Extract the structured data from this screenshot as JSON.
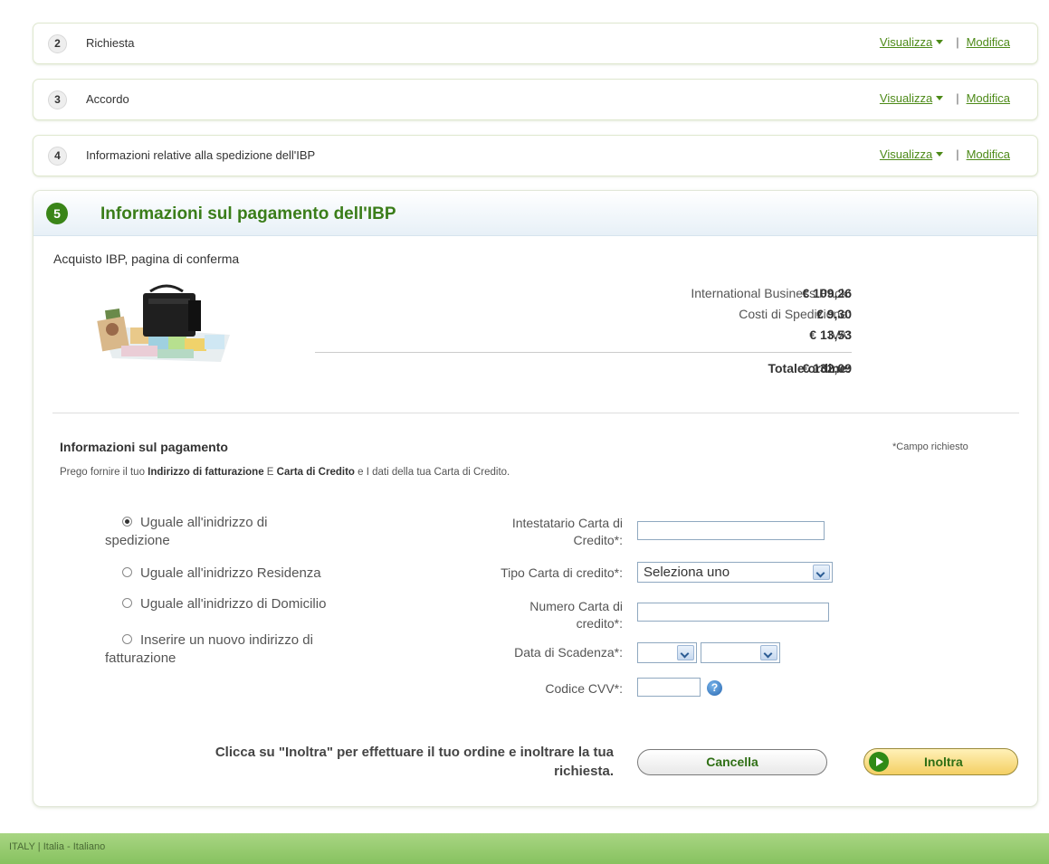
{
  "steps": [
    {
      "num": "2",
      "title": "Richiesta",
      "view_label": "Visualizza",
      "edit_label": "Modifica"
    },
    {
      "num": "3",
      "title": "Accordo",
      "view_label": "Visualizza",
      "edit_label": "Modifica"
    },
    {
      "num": "4",
      "title": "Informazioni relative alla spedizione dell'IBP",
      "view_label": "Visualizza",
      "edit_label": "Modifica"
    }
  ],
  "separator": "|",
  "panel": {
    "num": "5",
    "title": "Informazioni sul pagamento dell'IBP"
  },
  "confirmation": {
    "title": "Acquisto IBP, pagina di conferma",
    "summary": [
      {
        "label": "International Business Pack:",
        "value": "€ 109,26"
      },
      {
        "label": "Costi di Spedizione:",
        "value": "€ 9,30"
      },
      {
        "label": "IVA:",
        "value": "€ 13,53"
      }
    ],
    "total_label": "Totale ordine:",
    "total_value": "€ 132,09"
  },
  "payment": {
    "title": "Informazioni sul pagamento",
    "required_note": "*Campo richiesto",
    "instr_pre": "Prego fornire il tuo ",
    "instr_b1": "Indirizzo di fatturazione",
    "instr_mid": " E ",
    "instr_b2": "Carta di Credito",
    "instr_post": " e I dati della tua Carta di Credito.",
    "address_options": [
      {
        "line1": "Uguale all'inidrizzo di",
        "line2": "spedizione",
        "checked": true
      },
      {
        "line1": "Uguale all'inidrizzo Residenza",
        "line2": "",
        "checked": false
      },
      {
        "line1": "Uguale all'inidrizzo di Domicilio",
        "line2": "",
        "checked": false
      },
      {
        "line1": "Inserire un nuovo indirizzo di",
        "line2": "fatturazione",
        "checked": false
      }
    ],
    "fields": {
      "holder_label_1": "Intestatario Carta di",
      "holder_label_2": "Credito*:",
      "holder_value": "",
      "type_label": "Tipo Carta di credito*:",
      "type_value": "Seleziona uno",
      "number_label_1": "Numero Carta di",
      "number_label_2": "credito*:",
      "number_value": "",
      "expiry_label": "Data di Scadenza*:",
      "expiry_month": "",
      "expiry_year": "",
      "cvv_label": "Codice CVV*:",
      "cvv_value": ""
    },
    "submit_note_1": "Clicca su \"Inoltra\" per effettuare il tuo ordine e inoltrare la tua",
    "submit_note_2": "richiesta.",
    "cancel_label": "Cancella",
    "submit_label": "Inoltra"
  },
  "footer": {
    "text": "ITALY | Italia - Italiano"
  },
  "colors": {
    "accent_green": "#3a8518",
    "link_green": "#4d8a18",
    "footer_green": "#98cc6f"
  }
}
